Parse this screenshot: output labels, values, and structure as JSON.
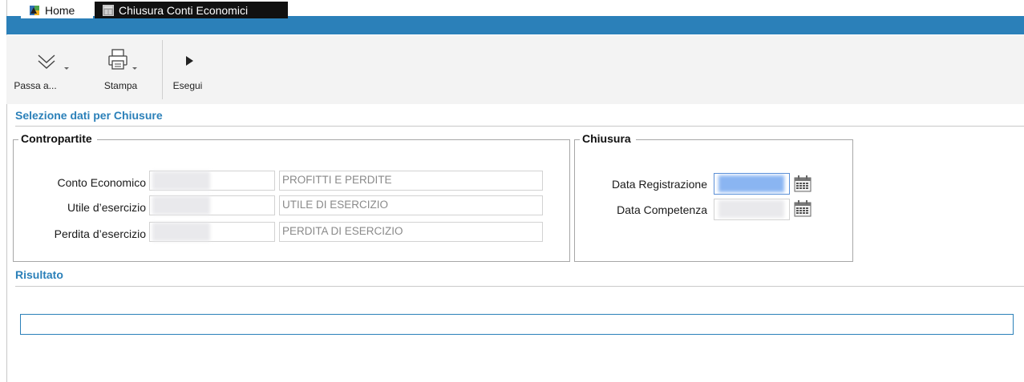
{
  "tabs": {
    "home_label": "Home",
    "active_label": "Chiusura Conti Economici"
  },
  "toolbar": {
    "passa_label": "Passa a...",
    "stampa_label": "Stampa",
    "esegui_label": "Esegui"
  },
  "sections": {
    "selezione_title": "Selezione dati per Chiusure",
    "risultato_title": "Risultato"
  },
  "contropartite": {
    "legend": "Contropartite",
    "rows": [
      {
        "label": "Conto Economico",
        "description": "PROFITTI E PERDITE"
      },
      {
        "label": "Utile d’esercizio",
        "description": "UTILE DI ESERCIZIO"
      },
      {
        "label": "Perdita d’esercizio",
        "description": "PERDITA DI ESERCIZIO"
      }
    ]
  },
  "chiusura": {
    "legend": "Chiusura",
    "data_registrazione_label": "Data Registrazione",
    "data_competenza_label": "Data Competenza"
  },
  "colors": {
    "accent": "#2b80b9",
    "active_tab_bg": "#111111",
    "focus_field": "#7fb0f0"
  },
  "icons": {
    "home_tab": "home-app-icon",
    "active_tab": "window-icon",
    "passa": "double-chevron-down-icon",
    "stampa": "printer-icon",
    "esegui": "play-icon",
    "date_picker": "calendar-icon"
  }
}
